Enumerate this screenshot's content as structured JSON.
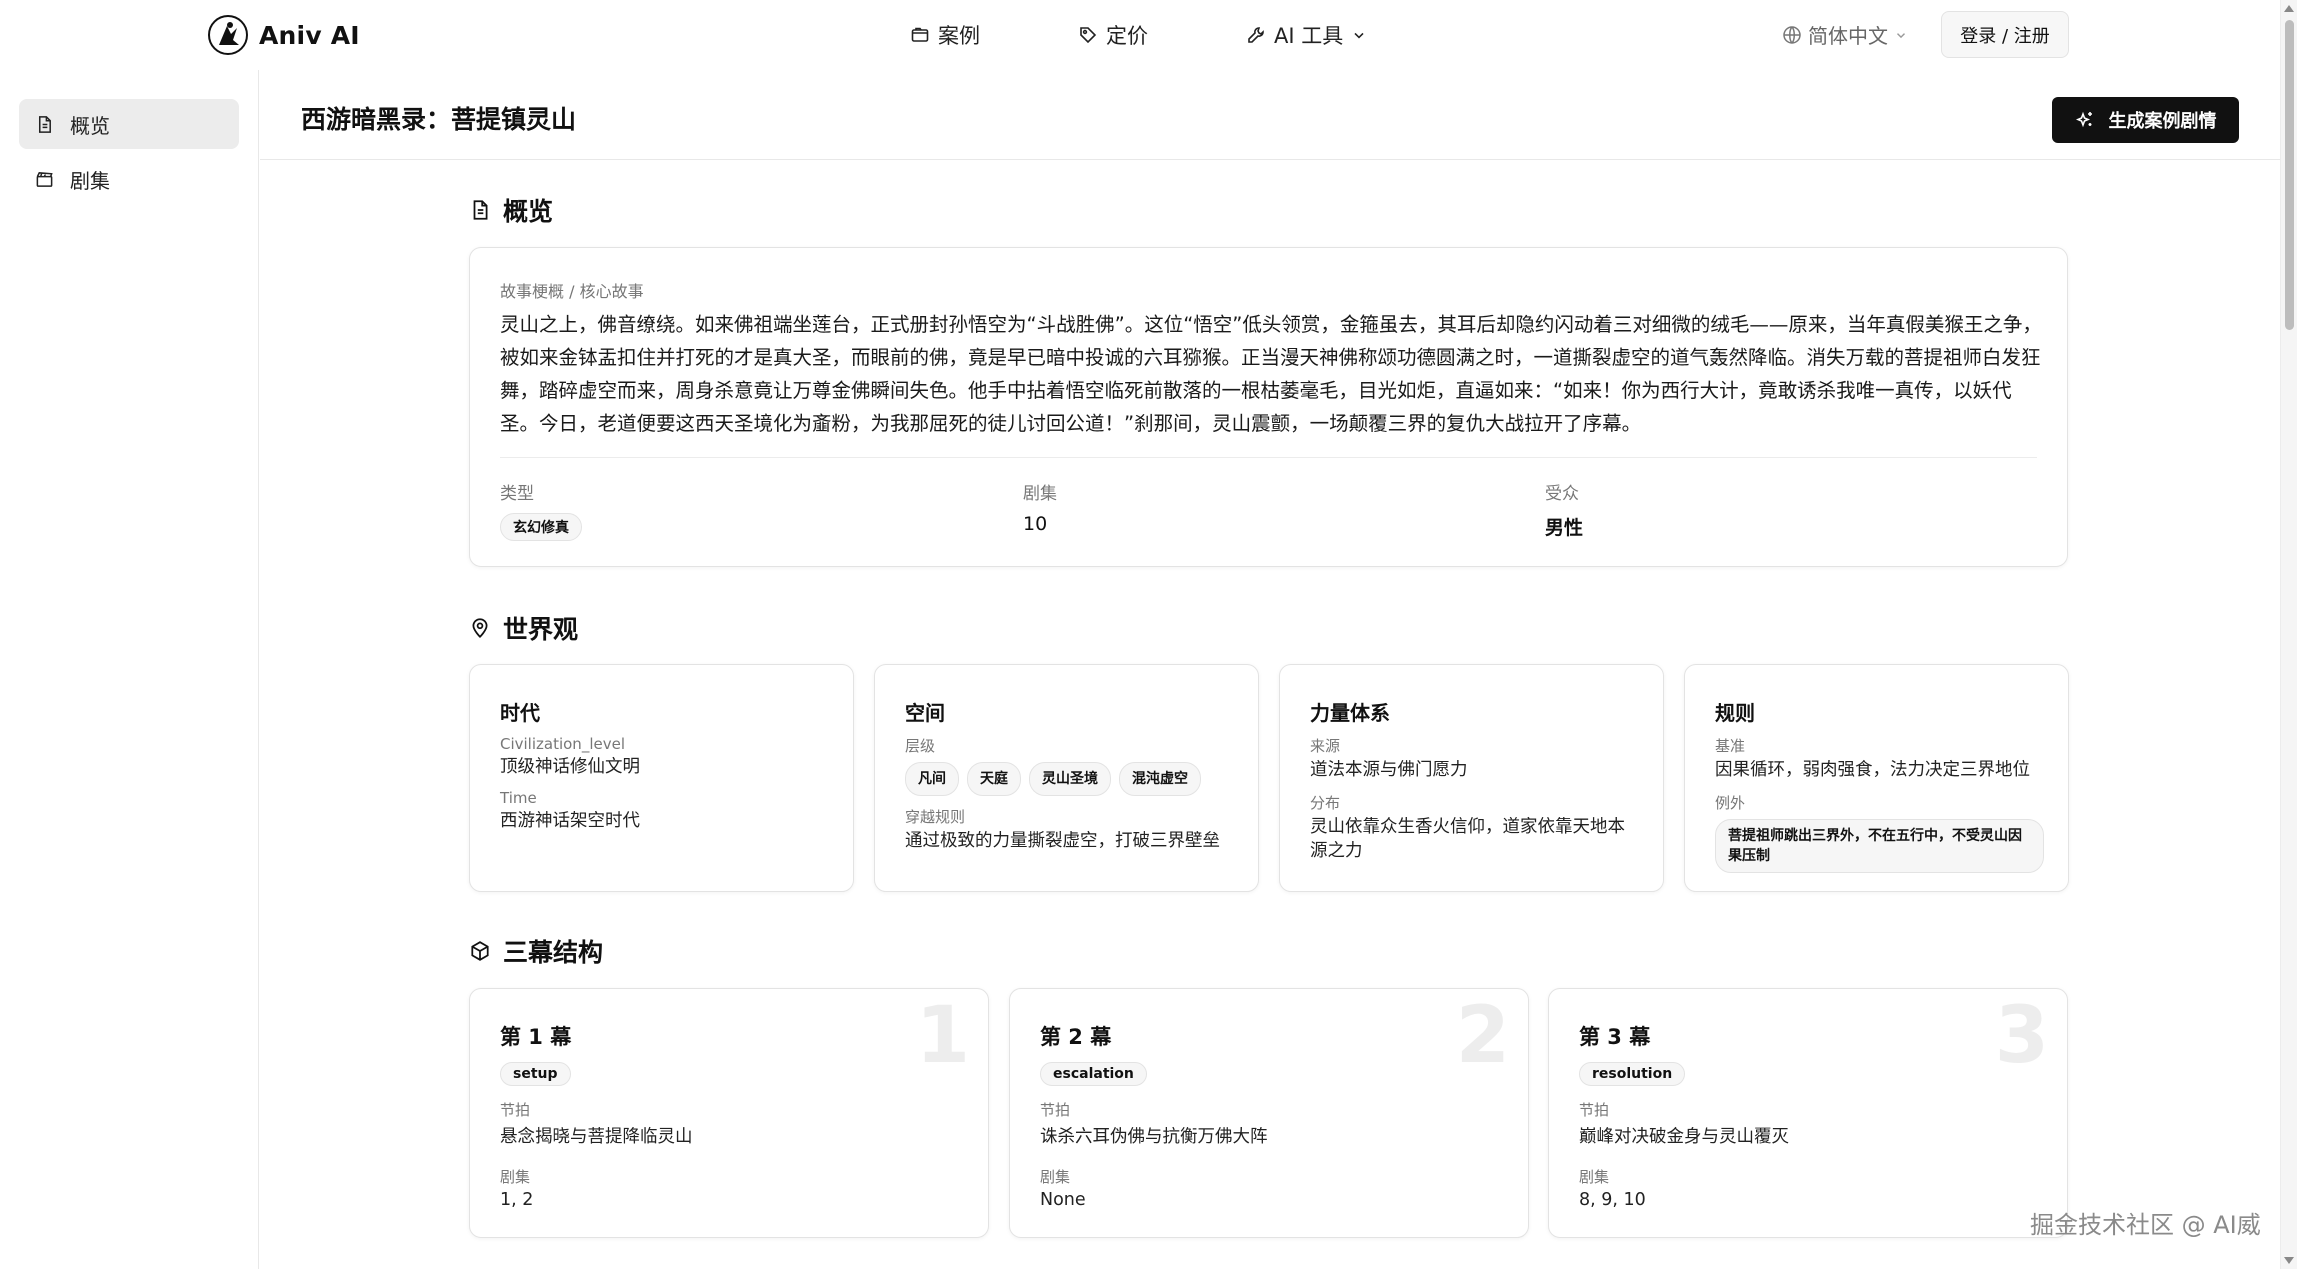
{
  "brand": {
    "name": "Aniv AI"
  },
  "nav": {
    "items": [
      {
        "label": "案例",
        "icon": "folder-icon"
      },
      {
        "label": "定价",
        "icon": "tag-icon"
      },
      {
        "label": "AI 工具",
        "icon": "wrench-icon"
      }
    ],
    "language": "简体中文",
    "login": "登录 / 注册"
  },
  "sidebar": {
    "items": [
      {
        "label": "概览",
        "icon": "document-icon",
        "active": true
      },
      {
        "label": "剧集",
        "icon": "clapperboard-icon",
        "active": false
      }
    ]
  },
  "header": {
    "title": "西游暗黑录：菩提镇灵山",
    "generate_button": "生成案例剧情"
  },
  "overview": {
    "section_title": "概览",
    "story_label": "故事梗概 / 核心故事",
    "story_text": "灵山之上，佛音缭绕。如来佛祖端坐莲台，正式册封孙悟空为“斗战胜佛”。这位“悟空”低头领赏，金箍虽去，其耳后却隐约闪动着三对细微的绒毛——原来，当年真假美猴王之争，被如来金钵盂扣住并打死的才是真大圣，而眼前的佛，竟是早已暗中投诚的六耳猕猴。正当漫天神佛称颂功德圆满之时，一道撕裂虚空的道气轰然降临。消失万载的菩提祖师白发狂舞，踏碎虚空而来，周身杀意竟让万尊金佛瞬间失色。他手中拈着悟空临死前散落的一根枯萎毫毛，目光如炬，直逼如来：“如来！你为西行大计，竟敢诱杀我唯一真传，以妖代圣。今日，老道便要这西天圣境化为齑粉，为我那屈死的徒儿讨回公道！”刹那间，灵山震颤，一场颠覆三界的复仇大战拉开了序幕。",
    "genre_label": "类型",
    "genre_value": "玄幻修真",
    "episodes_label": "剧集",
    "episodes_value": "10",
    "audience_label": "受众",
    "audience_value": "男性"
  },
  "worldview": {
    "section_title": "世界观",
    "era": {
      "title": "时代",
      "level_label": "Civilization_level",
      "level_value": "顶级神话修仙文明",
      "time_label": "Time",
      "time_value": "西游神话架空时代"
    },
    "space": {
      "title": "空间",
      "levels_label": "层级",
      "levels": [
        "凡间",
        "天庭",
        "灵山圣境",
        "混沌虚空"
      ],
      "rule_label": "穿越规则",
      "rule_value": "通过极致的力量撕裂虚空，打破三界壁垒"
    },
    "power": {
      "title": "力量体系",
      "source_label": "来源",
      "source_value": "道法本源与佛门愿力",
      "dist_label": "分布",
      "dist_value": "灵山依靠众生香火信仰，道家依靠天地本源之力"
    },
    "rules": {
      "title": "规则",
      "base_label": "基准",
      "base_value": "因果循环，弱肉强食，法力决定三界地位",
      "exception_label": "例外",
      "exception_value": "菩提祖师跳出三界外，不在五行中，不受灵山因果压制"
    }
  },
  "acts": {
    "section_title": "三幕结构",
    "beat_label": "节拍",
    "episodes_label": "剧集",
    "items": [
      {
        "title": "第 1 幕",
        "number": "1",
        "tag": "setup",
        "beat": "悬念揭晓与菩提降临灵山",
        "episodes": "1, 2"
      },
      {
        "title": "第 2 幕",
        "number": "2",
        "tag": "escalation",
        "beat": "诛杀六耳伪佛与抗衡万佛大阵",
        "episodes": "None"
      },
      {
        "title": "第 3 幕",
        "number": "3",
        "tag": "resolution",
        "beat": "巅峰对决破金身与灵山覆灭",
        "episodes": "8, 9, 10"
      }
    ]
  },
  "watermark": "掘金技术社区 @ AI威"
}
